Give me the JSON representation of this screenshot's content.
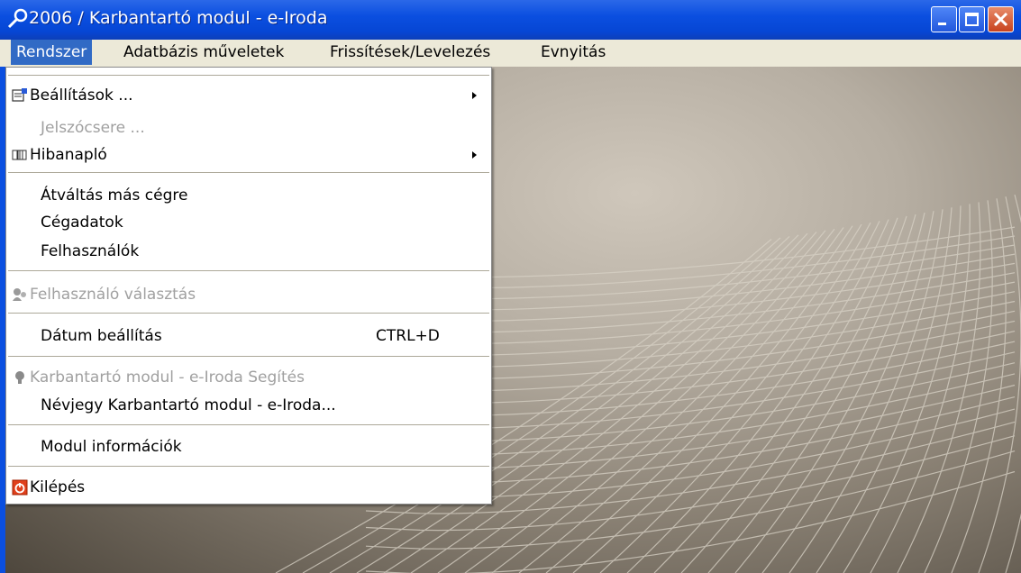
{
  "window": {
    "title": "2006 / Karbantartó modul - e-Iroda"
  },
  "menubar": [
    {
      "label": "Rendszer",
      "active": true
    },
    {
      "label": "Adatbázis műveletek",
      "active": false
    },
    {
      "label": "Frissítések/Levelezés",
      "active": false
    },
    {
      "label": "Evnyitás",
      "active": false
    }
  ],
  "menu": {
    "items": {
      "beallitasok": "Beállítások ...",
      "jelszocsere": "Jelszócsere ...",
      "hibanaplo": "Hibanapló",
      "atvaltas": "Átváltás más cégre",
      "cegadatok": "Cégadatok",
      "felhasznalok": "Felhasználók",
      "felhasznalo_valasztas": "Felhasználó választás",
      "datum_beallitas": "Dátum beállítás",
      "datum_shortcut": "CTRL+D",
      "segites": "Karbantartó modul - e-Iroda Segítés",
      "nevjegy": "Névjegy Karbantartó modul - e-Iroda...",
      "modul_info": "Modul információk",
      "kilepes": "Kilépés"
    }
  },
  "colors": {
    "titlebar": "#0b4fe0",
    "menu_highlight": "#316ac5",
    "disabled_text": "#a0a0a0"
  }
}
